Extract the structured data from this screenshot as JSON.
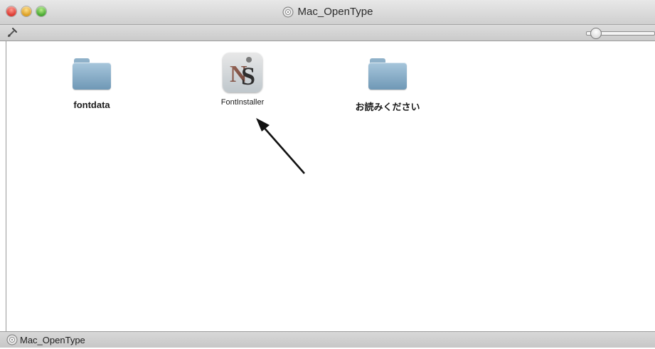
{
  "window": {
    "title": "Mac_OpenType"
  },
  "toolbar": {
    "tool_icon": "wrench-icon",
    "slider_icon": "icon-size-slider",
    "slider_value": 0.15
  },
  "items": [
    {
      "label": "fontdata",
      "icon": "folder-icon"
    },
    {
      "label": "FontInstaller",
      "icon": "app-icon"
    },
    {
      "label": "お読みください",
      "icon": "folder-icon"
    }
  ],
  "status": {
    "path_label": "Mac_OpenType"
  },
  "annotation": {
    "arrow": "arrow-pointing-to-fontinstaller"
  }
}
